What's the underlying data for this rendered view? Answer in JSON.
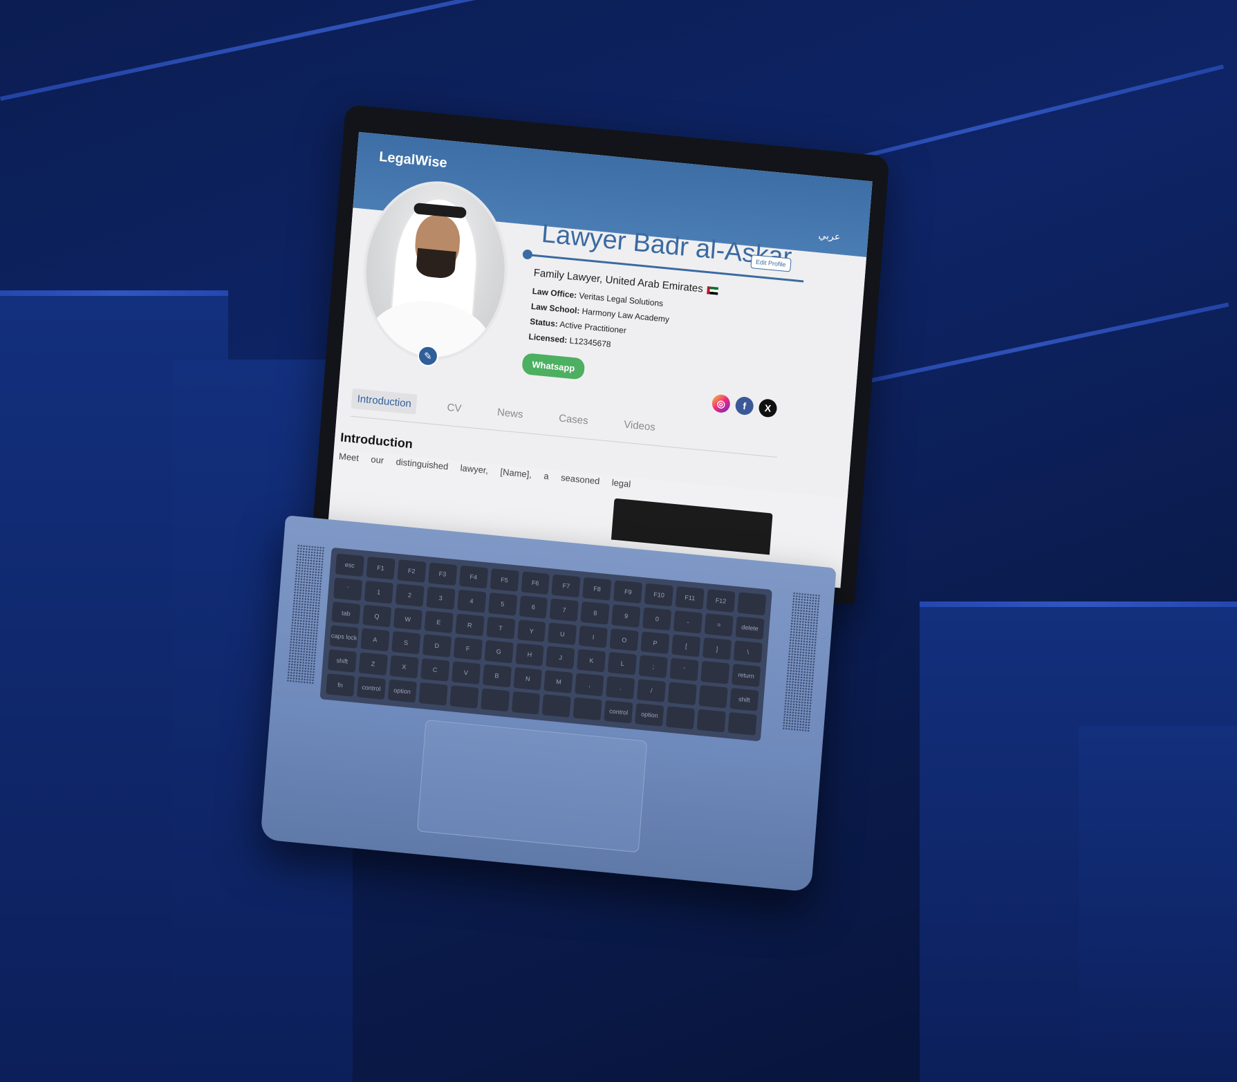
{
  "site": {
    "brand": "LegalWise",
    "language_switch": "عربي"
  },
  "profile": {
    "name": "Lawyer Badr al-Askar",
    "edit_profile_label": "Edit Profile",
    "title": "Family Lawyer, United Arab Emirates",
    "law_office_label": "Law Office:",
    "law_office": "Veritas Legal Solutions",
    "law_school_label": "Law School:",
    "law_school": "Harmony Law Academy",
    "status_label": "Status:",
    "status": "Active Practitioner",
    "licensed_label": "Licensed:",
    "licensed": "L12345678",
    "whatsapp_label": "Whatsapp"
  },
  "socials": [
    {
      "name": "instagram-icon",
      "glyph": "◎"
    },
    {
      "name": "facebook-icon",
      "glyph": "f"
    },
    {
      "name": "x-icon",
      "glyph": "X"
    }
  ],
  "tabs": [
    {
      "label": "Introduction",
      "active": true
    },
    {
      "label": "CV",
      "active": false
    },
    {
      "label": "News",
      "active": false
    },
    {
      "label": "Cases",
      "active": false
    },
    {
      "label": "Videos",
      "active": false
    }
  ],
  "intro": {
    "heading": "Introduction",
    "text": "Meet our distinguished lawyer, [Name], a seasoned legal"
  },
  "keyboard": {
    "keys": [
      "esc",
      "F1",
      "F2",
      "F3",
      "F4",
      "F5",
      "F6",
      "F7",
      "F8",
      "F9",
      "F10",
      "F11",
      "F12",
      "",
      "`",
      "1",
      "2",
      "3",
      "4",
      "5",
      "6",
      "7",
      "8",
      "9",
      "0",
      "-",
      "=",
      "delete",
      "tab",
      "Q",
      "W",
      "E",
      "R",
      "T",
      "Y",
      "U",
      "I",
      "O",
      "P",
      "[",
      "]",
      "\\",
      "caps lock",
      "A",
      "S",
      "D",
      "F",
      "G",
      "H",
      "J",
      "K",
      "L",
      ";",
      "'",
      "",
      "return",
      "shift",
      "Z",
      "X",
      "C",
      "V",
      "B",
      "N",
      "M",
      ",",
      ".",
      "/",
      "",
      "",
      "shift",
      "fn",
      "control",
      "option",
      "",
      "",
      "",
      "",
      "",
      "",
      "control",
      "option",
      "",
      "",
      ""
    ]
  },
  "colors": {
    "brand": "#3d6ea5",
    "whatsapp": "#4caf61",
    "background": "#0e2466"
  }
}
